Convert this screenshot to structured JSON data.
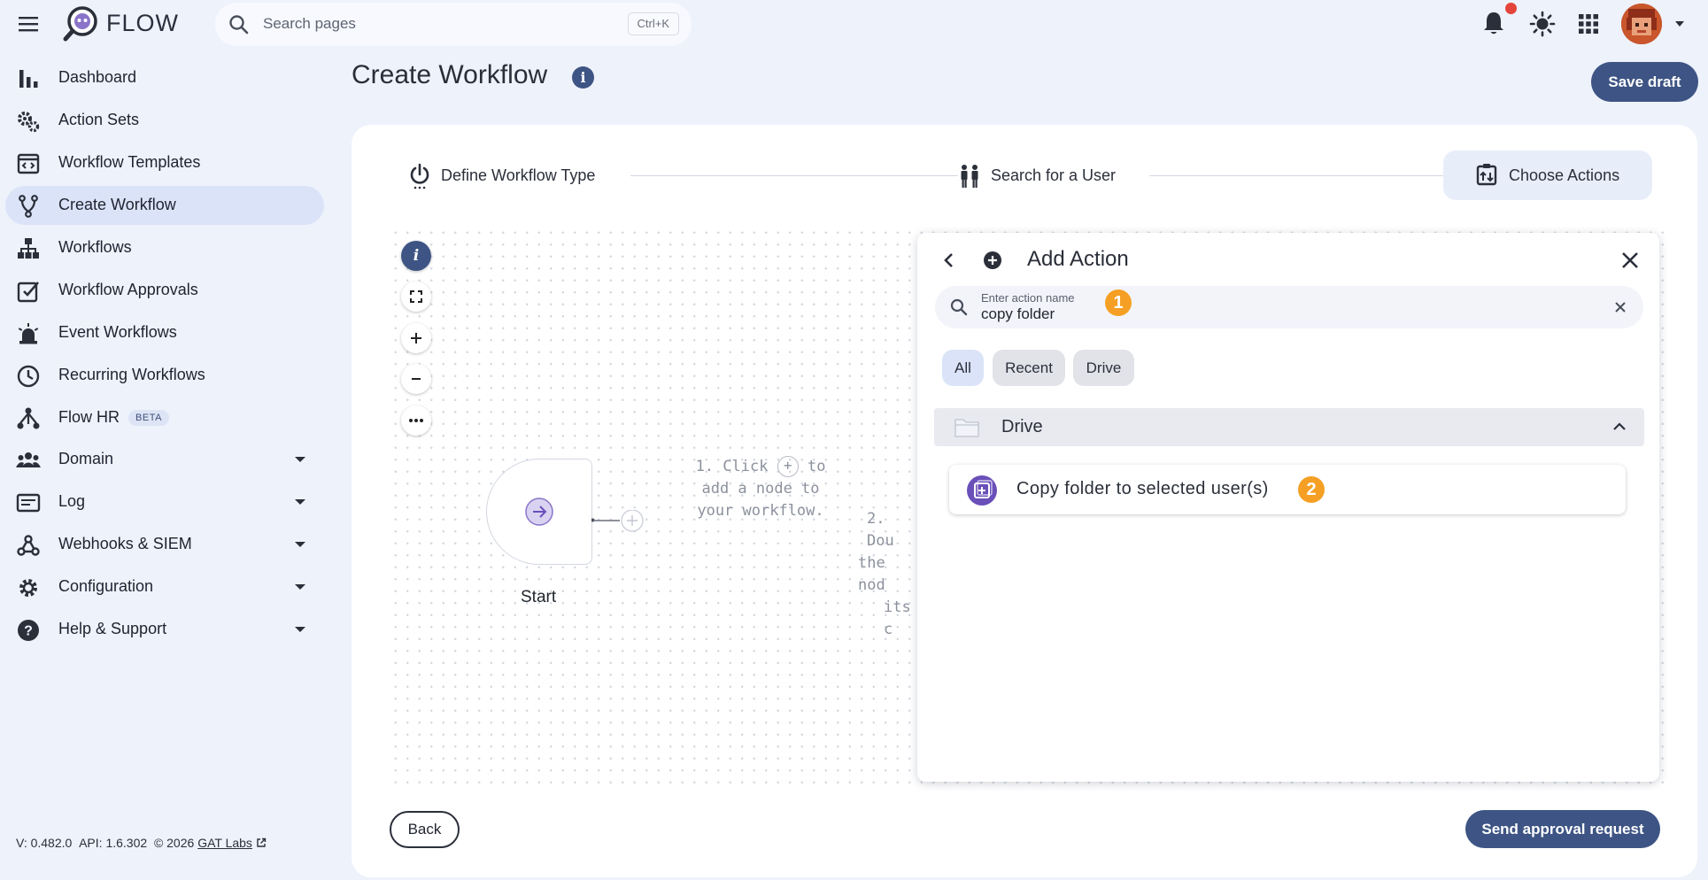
{
  "app": {
    "name": "FLOW"
  },
  "search": {
    "placeholder": "Search pages",
    "shortcut": "Ctrl+K"
  },
  "sidebar": {
    "items": [
      {
        "label": "Dashboard"
      },
      {
        "label": "Action Sets"
      },
      {
        "label": "Workflow Templates"
      },
      {
        "label": "Create Workflow",
        "active": true
      },
      {
        "label": "Workflows"
      },
      {
        "label": "Workflow Approvals"
      },
      {
        "label": "Event Workflows"
      },
      {
        "label": "Recurring Workflows"
      },
      {
        "label": "Flow HR",
        "badge": "BETA"
      },
      {
        "label": "Domain"
      },
      {
        "label": "Log"
      },
      {
        "label": "Webhooks & SIEM"
      },
      {
        "label": "Configuration"
      },
      {
        "label": "Help & Support"
      }
    ]
  },
  "footer": {
    "version": "V: 0.482.0",
    "api": "API: 1.6.302",
    "copyright": "© 2026",
    "company": "GAT Labs"
  },
  "page": {
    "title": "Create Workflow",
    "save_draft": "Save draft"
  },
  "stepper": {
    "steps": [
      {
        "label": "Define Workflow Type"
      },
      {
        "label": "Search for a User"
      },
      {
        "label": "Choose Actions",
        "active": true
      }
    ]
  },
  "canvas": {
    "start_label": "Start",
    "hint1": [
      "1. Click",
      "to",
      "add a node to",
      "your workflow."
    ],
    "hint2": [
      "2. Dou",
      "the nod",
      "its c"
    ]
  },
  "panel": {
    "title": "Add Action",
    "search_label": "Enter action name",
    "search_value": "copy folder",
    "badge1": "1",
    "badge2": "2",
    "chips": [
      "All",
      "Recent",
      "Drive"
    ],
    "group": "Drive",
    "action": "Copy folder to selected user(s)"
  },
  "buttons": {
    "back": "Back",
    "send": "Send approval request"
  },
  "colors": {
    "primary": "#3d5484",
    "accent_badge": "#f5a024",
    "notification": "#e4453a",
    "action_icon": "#6a4fb8"
  },
  "icons": [
    "menu-icon",
    "flow-logo-icon",
    "search-icon",
    "bell-icon",
    "sun-icon",
    "apps-grid-icon",
    "user-avatar"
  ]
}
